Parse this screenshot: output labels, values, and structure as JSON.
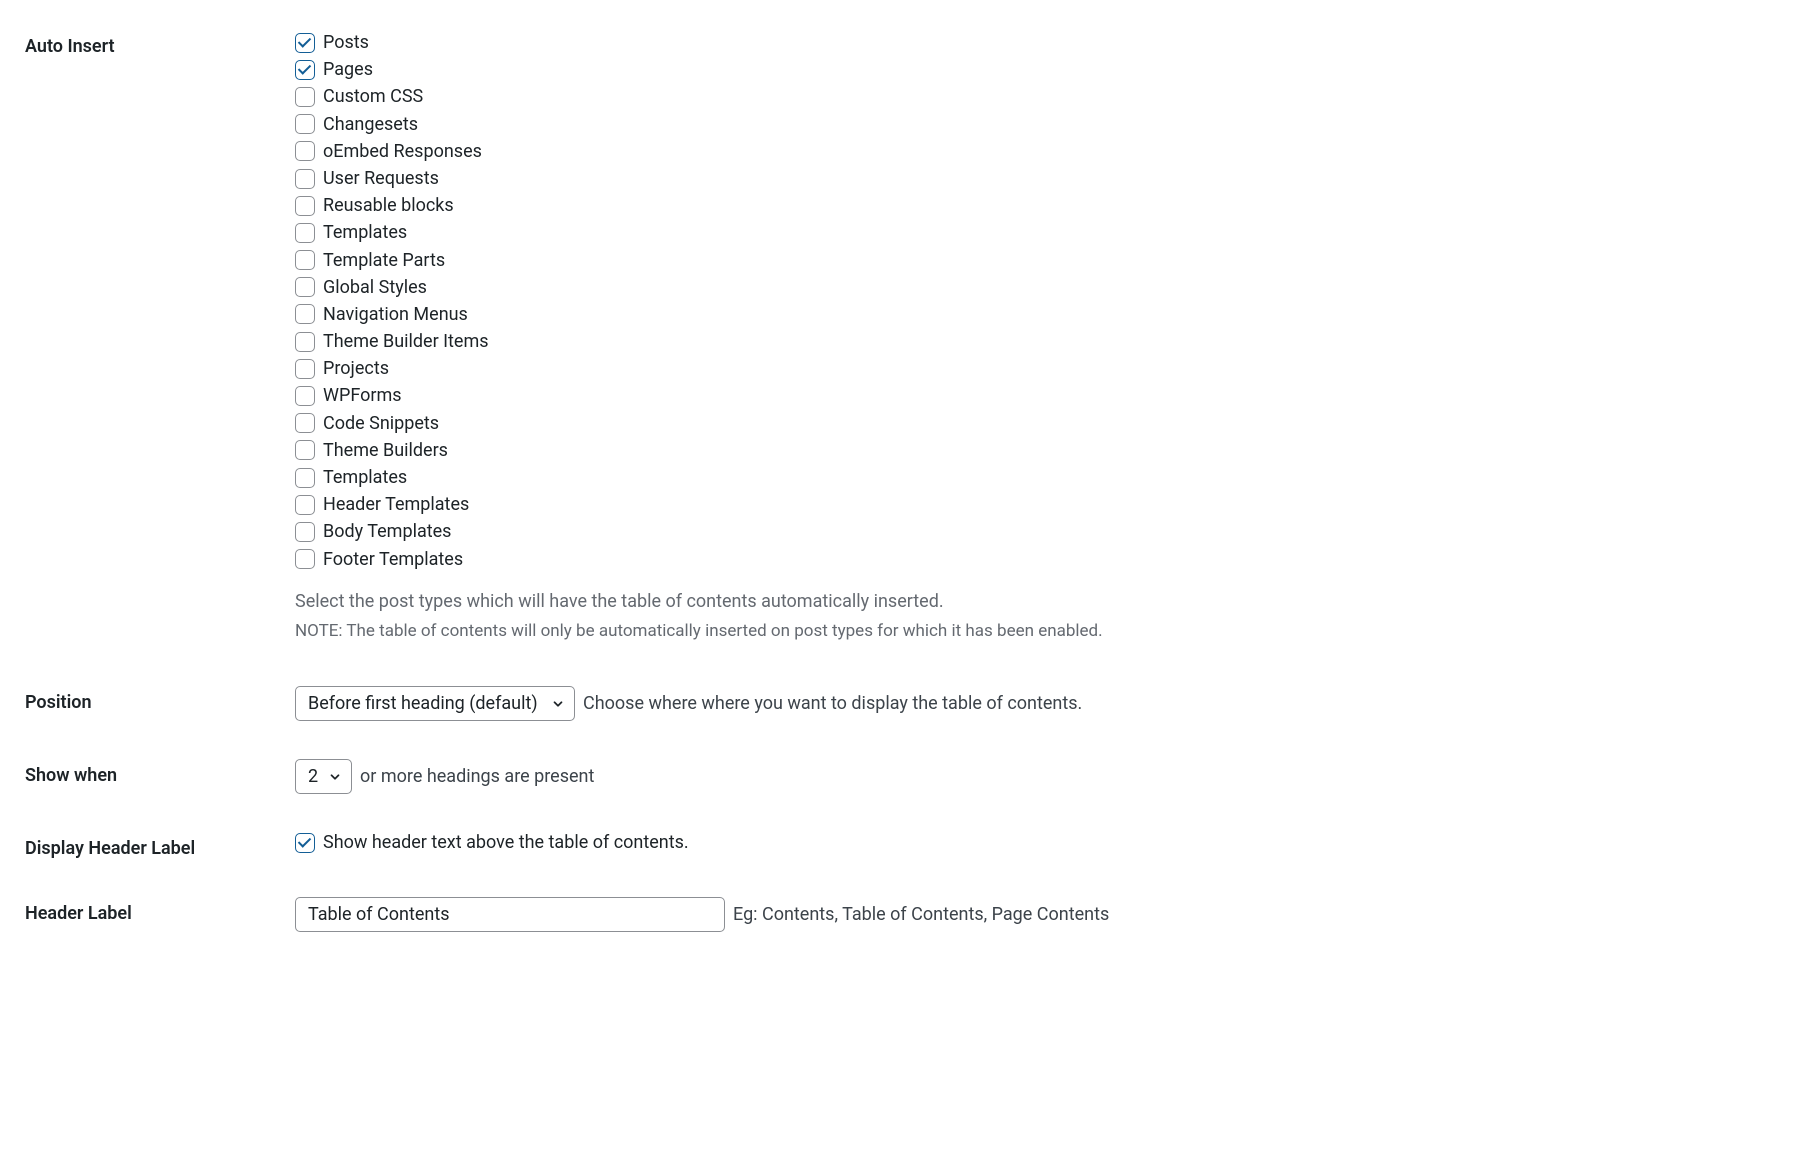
{
  "autoInsert": {
    "label": "Auto Insert",
    "items": [
      {
        "label": "Posts",
        "checked": true
      },
      {
        "label": "Pages",
        "checked": true
      },
      {
        "label": "Custom CSS",
        "checked": false
      },
      {
        "label": "Changesets",
        "checked": false
      },
      {
        "label": "oEmbed Responses",
        "checked": false
      },
      {
        "label": "User Requests",
        "checked": false
      },
      {
        "label": "Reusable blocks",
        "checked": false
      },
      {
        "label": "Templates",
        "checked": false
      },
      {
        "label": "Template Parts",
        "checked": false
      },
      {
        "label": "Global Styles",
        "checked": false
      },
      {
        "label": "Navigation Menus",
        "checked": false
      },
      {
        "label": "Theme Builder Items",
        "checked": false
      },
      {
        "label": "Projects",
        "checked": false
      },
      {
        "label": "WPForms",
        "checked": false
      },
      {
        "label": "Code Snippets",
        "checked": false
      },
      {
        "label": "Theme Builders",
        "checked": false
      },
      {
        "label": "Templates",
        "checked": false
      },
      {
        "label": "Header Templates",
        "checked": false
      },
      {
        "label": "Body Templates",
        "checked": false
      },
      {
        "label": "Footer Templates",
        "checked": false
      }
    ],
    "help": "Select the post types which will have the table of contents automatically inserted.",
    "note": "NOTE: The table of contents will only be automatically inserted on post types for which it has been enabled."
  },
  "position": {
    "label": "Position",
    "selected": "Before first heading (default)",
    "help": "Choose where where you want to display the table of contents."
  },
  "showWhen": {
    "label": "Show when",
    "selected": "2",
    "suffix": "or more headings are present"
  },
  "displayHeaderLabel": {
    "label": "Display Header Label",
    "checked": true,
    "text": "Show header text above the table of contents."
  },
  "headerLabel": {
    "label": "Header Label",
    "value": "Table of Contents",
    "help": "Eg: Contents, Table of Contents, Page Contents"
  }
}
